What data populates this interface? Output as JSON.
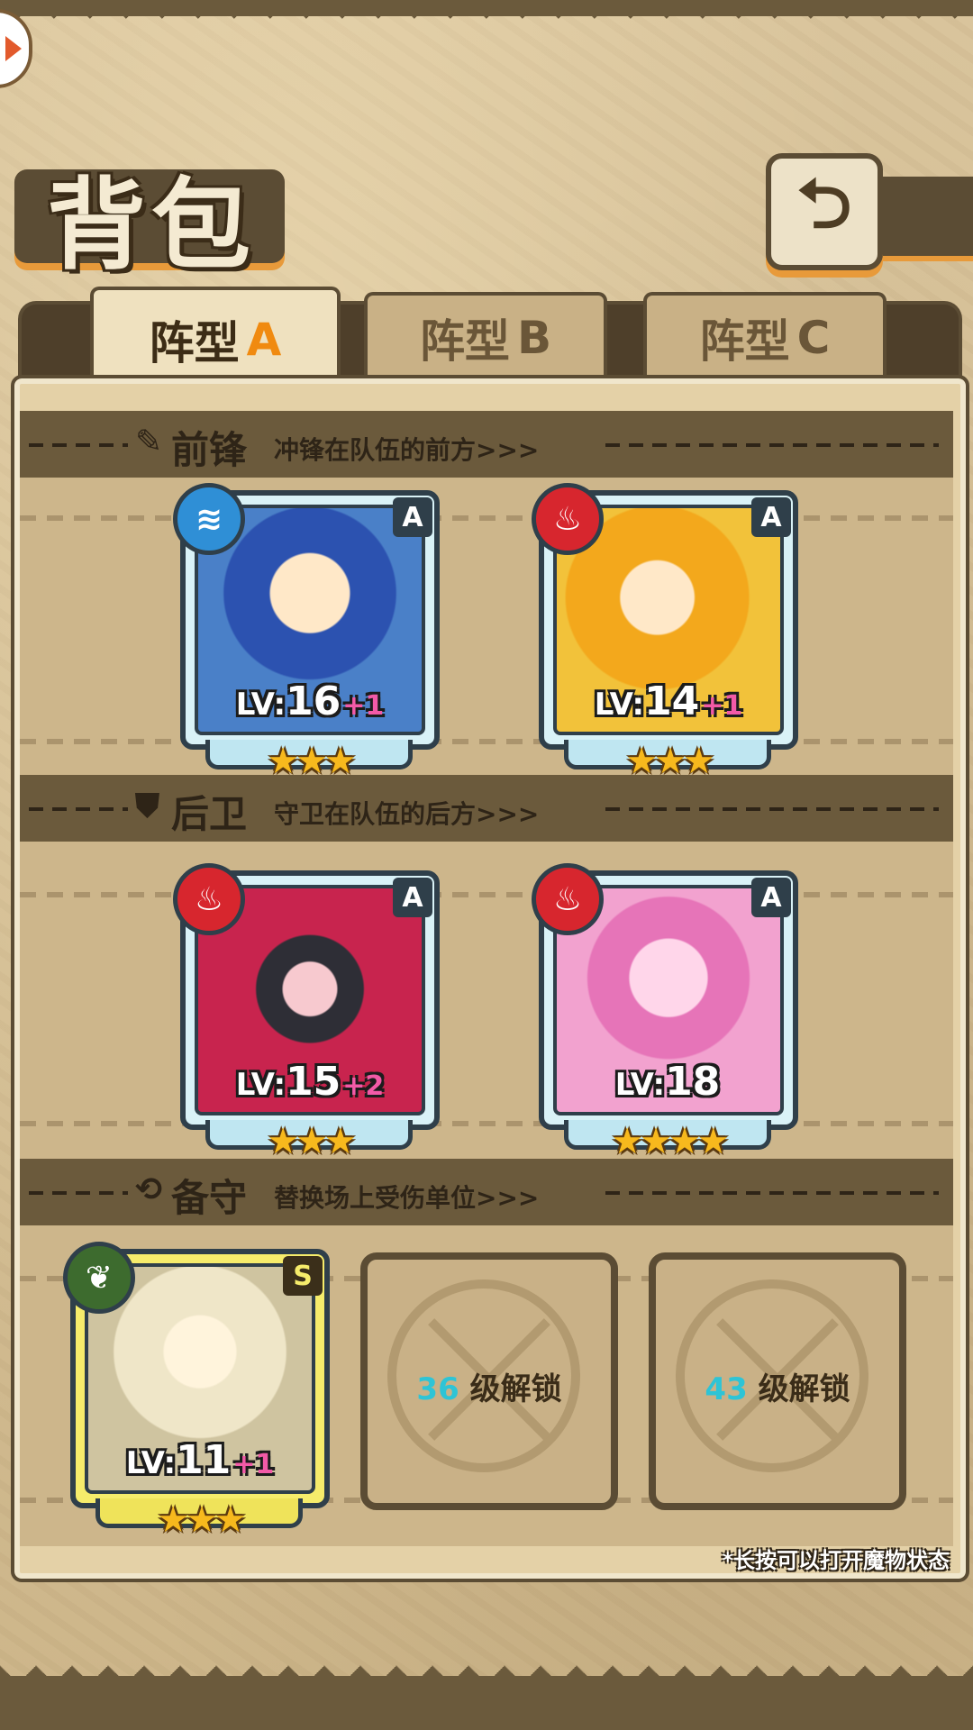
{
  "page": {
    "title": "背包"
  },
  "back_icon": "back-arrow-icon",
  "tabs": [
    {
      "label": "阵型",
      "letter": "A",
      "active": true
    },
    {
      "label": "阵型",
      "letter": "B",
      "active": false
    },
    {
      "label": "阵型",
      "letter": "C",
      "active": false
    }
  ],
  "sections": {
    "front": {
      "icon": "sword-icon",
      "title": "前锋",
      "desc": "冲锋在队伍的前方>>>"
    },
    "back": {
      "icon": "shield-icon",
      "title": "后卫",
      "desc": "守卫在队伍的后方>>>"
    },
    "reserve": {
      "icon": "swap-icon",
      "title": "备守",
      "desc": "替换场上受伤单位>>>"
    }
  },
  "cards": {
    "front1": {
      "element": "water-icon",
      "rank": "A",
      "lv_prefix": "LV:",
      "level": "16",
      "plus": "+1",
      "stars": "★★★",
      "colors": {
        "bg": "#4a80c8",
        "hair": "#2c52b0"
      }
    },
    "front2": {
      "element": "fire-icon",
      "rank": "A",
      "lv_prefix": "LV:",
      "level": "14",
      "plus": "+1",
      "stars": "★★★",
      "colors": {
        "bg": "#f2c23a",
        "hair": "#f3a81c"
      }
    },
    "back1": {
      "element": "fire-icon",
      "rank": "A",
      "lv_prefix": "LV:",
      "level": "15",
      "plus": "+2",
      "stars": "★★★",
      "colors": {
        "bg": "#c8244e",
        "hair": "#2e2e36"
      }
    },
    "back2": {
      "element": "fire-icon",
      "rank": "A",
      "lv_prefix": "LV:",
      "level": "18",
      "plus": "",
      "stars": "★★★★",
      "colors": {
        "bg": "#f2a2cf",
        "hair": "#e674b8"
      }
    },
    "reserve1": {
      "element": "leaf-icon",
      "rank": "S",
      "lv_prefix": "LV:",
      "level": "11",
      "plus": "+1",
      "stars": "★★★",
      "colors": {
        "bg": "#e6ddc0",
        "hair": "#efe6c8"
      }
    }
  },
  "locked": [
    {
      "level": "36",
      "text": "级解锁"
    },
    {
      "level": "43",
      "text": "级解锁"
    }
  ],
  "hint": "*长按可以打开魔物状态"
}
